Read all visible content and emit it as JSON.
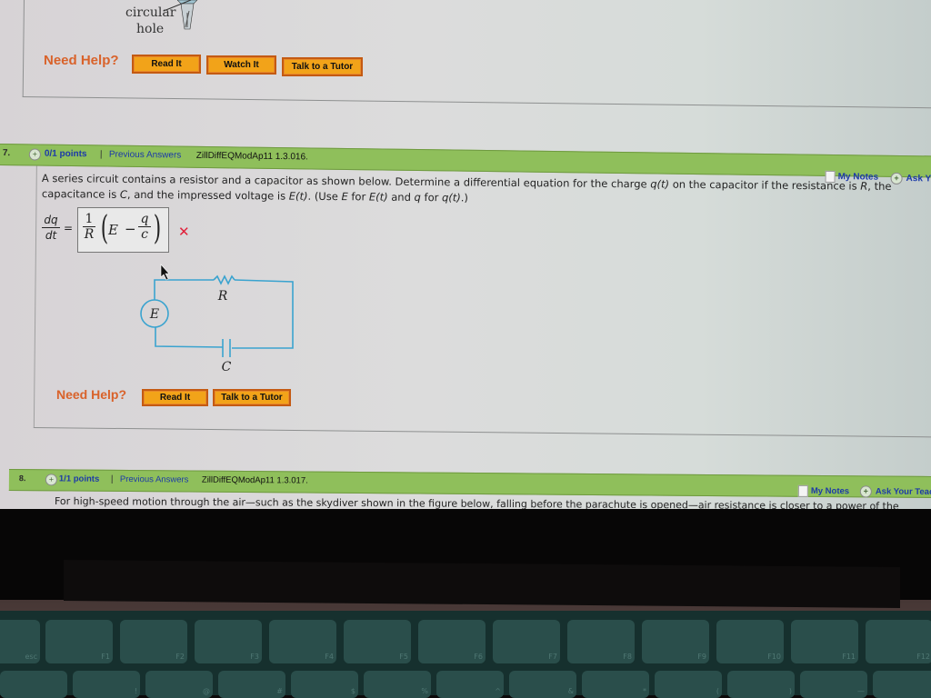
{
  "prev_question": {
    "figure_label_line1": "circular",
    "figure_label_line2": "hole",
    "need_help": "Need Help?",
    "buttons": [
      "Read It",
      "Watch It",
      "Talk to a Tutor"
    ]
  },
  "question7": {
    "number": "7.",
    "points": "0/1 points",
    "separator": "|",
    "previous_answers": "Previous Answers",
    "id": "ZillDiffEQModAp11 1.3.016.",
    "my_notes": "My Notes",
    "ask": "Ask Y",
    "text_line1_a": "A series circuit contains a resistor and a capacitor as shown below. Determine a differential equation for the charge ",
    "text_line1_q": "q(t)",
    "text_line1_b": " on the capacitor if the resistance is ",
    "text_line1_R": "R",
    "text_line1_c": ", the",
    "text_line2_a": "capacitance is ",
    "text_line2_C": "C",
    "text_line2_b": ", and the impressed voltage is ",
    "text_line2_E": "E(t)",
    "text_line2_c": ". (Use ",
    "text_line2_E2": "E",
    "text_line2_d": " for ",
    "text_line2_Et": "E(t)",
    "text_line2_e": " and ",
    "text_line2_q": "q",
    "text_line2_f": " for ",
    "text_line2_qt": "q(t)",
    "text_line2_g": ".)",
    "lhs_num": "dq",
    "lhs_den": "dt",
    "equals": "=",
    "answer": {
      "coef_num": "1",
      "coef_den": "R",
      "open_paren": "(",
      "E": "E",
      "minus": "−",
      "frac_num": "q",
      "frac_den": "c",
      "close_paren": ")"
    },
    "result_mark": "✕",
    "result": "incorrect",
    "circuit": {
      "source_label": "E",
      "resistor_label": "R",
      "capacitor_label": "C"
    },
    "need_help": "Need Help?",
    "buttons": [
      "Read It",
      "Talk to a Tutor"
    ]
  },
  "question8": {
    "number": "8.",
    "points": "1/1 points",
    "separator": "|",
    "previous_answers": "Previous Answers",
    "id": "ZillDiffEQModAp11 1.3.017.",
    "my_notes": "My Notes",
    "ask": "Ask Your Teac",
    "text_line1": "For high-speed motion through the air—such as the skydiver shown in the figure below, falling before the parachute is opened—air resistance is closer to a power of the"
  },
  "keyboard": {
    "keys": [
      "esc",
      "F1",
      "F2",
      "F3",
      "F4",
      "F5",
      "F6",
      "F7",
      "F8",
      "F9",
      "F10",
      "F11",
      "F12"
    ],
    "row2": [
      "",
      "!",
      "@",
      "#",
      "$",
      "%",
      "^",
      "&",
      "*",
      "(",
      ")",
      "—",
      "+"
    ]
  },
  "colors": {
    "question_bar": "#8fbf5b",
    "link_blue": "#1c3aa8",
    "need_help_orange": "#d9622a",
    "button_fill": "#f2a319",
    "button_border": "#c45a12",
    "incorrect_red": "#e0203a",
    "circuit_blue": "#3aa3cf"
  }
}
